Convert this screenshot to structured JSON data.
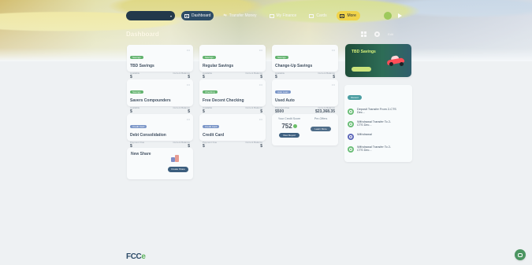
{
  "header": {
    "business_select": "",
    "nav": {
      "dashboard": "Dashboard",
      "transfer_money": "Transfer Money",
      "my_finance": "My Finance",
      "cards": "Cards",
      "more": "More"
    }
  },
  "page": {
    "title": "Dashboard"
  },
  "tools": {
    "label": "Edit"
  },
  "cards": [
    {
      "badge": "Savings",
      "title": "TBD Savings",
      "meta": "",
      "left_label": "Available",
      "left_value": "$",
      "right_label": "Current Balance",
      "right_value": "$"
    },
    {
      "badge": "Savings",
      "title": "Regular Savings",
      "meta": "",
      "left_label": "Available",
      "left_value": "$",
      "right_label": "Current Balance",
      "right_value": "$"
    },
    {
      "badge": "Savings",
      "title": "Change-Up Savings",
      "meta": "",
      "left_label": "Available",
      "left_value": "$",
      "right_label": "Current Balance",
      "right_value": "$"
    },
    {
      "badge": "Savings",
      "title": "Savers Compounders",
      "meta": "",
      "left_label": "Available",
      "left_value": "$",
      "right_label": "Current Balance",
      "right_value": "$"
    },
    {
      "badge": "Checking",
      "title": "Free Decent Checking",
      "meta": "",
      "left_label": "Available",
      "left_value": "$",
      "right_label": "Current Balance",
      "right_value": "$"
    },
    {
      "badge": "Auto Loan",
      "title": "Used Auto",
      "meta": "",
      "left_label": "Payment Due",
      "left_value": "$500",
      "right_label": "Current Balance",
      "right_value": "$23,368.35"
    },
    {
      "badge": "Credit Card",
      "title": "Debt Consolidation",
      "meta": "",
      "left_label": "Payment Due",
      "left_value": "$",
      "right_label": "Current Balance",
      "right_value": "$"
    },
    {
      "badge": "Credit Card",
      "title": "Credit Card",
      "meta": "",
      "left_label": "Payment Due",
      "left_value": "$",
      "right_label": "Current Balance",
      "right_value": "$"
    }
  ],
  "promo": {
    "title": "TBD Savings",
    "text": "",
    "cta": ""
  },
  "credit": {
    "score_label": "Your Credit Score",
    "score_value": "752",
    "score_sub": "",
    "score_cta": "View Report",
    "offers_label": "Pre-Offers",
    "offers_sub": "",
    "offers_cta": "Learn More"
  },
  "shares": {
    "title": "New Share",
    "copy": "",
    "button": "Create Share"
  },
  "recent": {
    "title": "Recent",
    "items": [
      {
        "title": "Deposit Transfer From 2-CTS Dec...",
        "date": "",
        "amount": ""
      },
      {
        "title": "Withdrawal Transfer To 2-CTS Dec...",
        "date": "",
        "amount": ""
      },
      {
        "title": "Withdrawal",
        "date": "",
        "amount": ""
      },
      {
        "title": "Withdrawal Transfer To 2-CTS Dec...",
        "date": "",
        "amount": ""
      }
    ]
  },
  "footer": {
    "logo_main": "FCC",
    "logo_accent": "e"
  },
  "colors": {
    "primary": "#2d4c66",
    "accent": "#f0d349",
    "success": "#62b36e",
    "info": "#7b96c8",
    "promo": "#1f4d39"
  }
}
